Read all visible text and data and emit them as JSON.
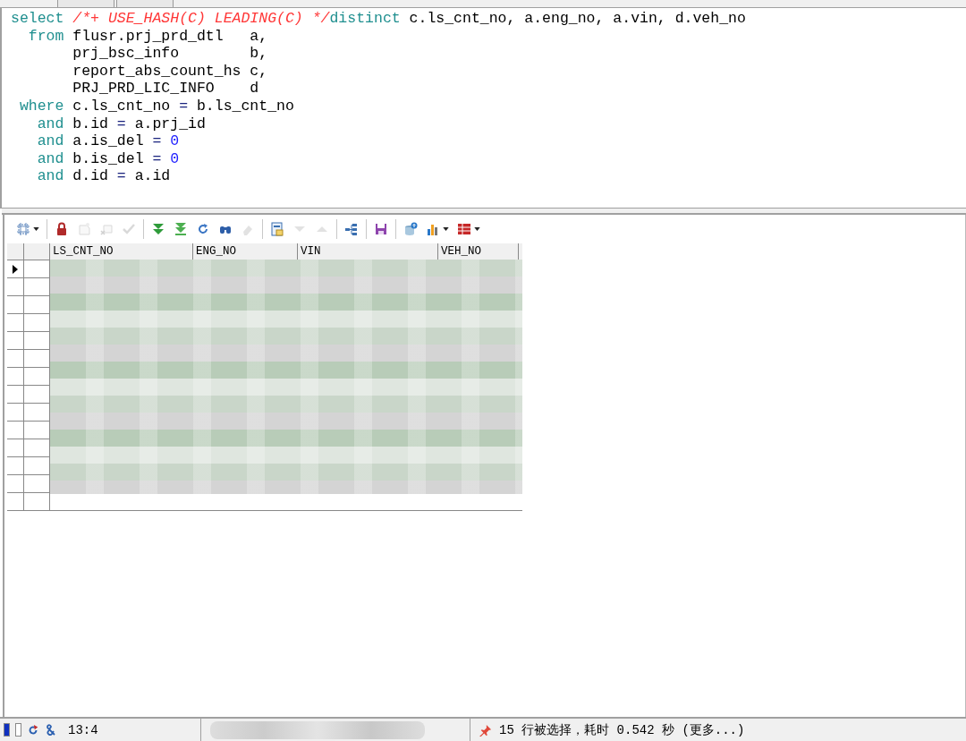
{
  "editor": {
    "lines": [
      [
        {
          "kind": "keyword",
          "text": "select "
        },
        {
          "kind": "comment",
          "text": "/*+ USE_HASH(C) LEADING(C) */"
        },
        {
          "kind": "keyword",
          "text": "distinct"
        },
        {
          "kind": "text",
          "text": " c.ls_cnt_no, a.eng_no, a.vin, d.veh_no"
        }
      ],
      [
        {
          "kind": "keyword",
          "text": "  from"
        },
        {
          "kind": "text",
          "text": " flusr.prj_prd_dtl   a,"
        }
      ],
      [
        {
          "kind": "text",
          "text": "       prj_bsc_info        b,"
        }
      ],
      [
        {
          "kind": "text",
          "text": "       report_abs_count_hs c,"
        }
      ],
      [
        {
          "kind": "text",
          "text": "       PRJ_PRD_LIC_INFO    d"
        }
      ],
      [
        {
          "kind": "keyword",
          "text": " where"
        },
        {
          "kind": "text",
          "text": " c.ls_cnt_no "
        },
        {
          "kind": "operator",
          "text": "="
        },
        {
          "kind": "text",
          "text": " b.ls_cnt_no"
        }
      ],
      [
        {
          "kind": "keyword",
          "text": "   and"
        },
        {
          "kind": "text",
          "text": " b.id "
        },
        {
          "kind": "operator",
          "text": "="
        },
        {
          "kind": "text",
          "text": " a.prj_id"
        }
      ],
      [
        {
          "kind": "keyword",
          "text": "   and"
        },
        {
          "kind": "text",
          "text": " a.is_del "
        },
        {
          "kind": "operator",
          "text": "= "
        },
        {
          "kind": "number",
          "text": "0"
        }
      ],
      [
        {
          "kind": "keyword",
          "text": "   and"
        },
        {
          "kind": "text",
          "text": " b.is_del "
        },
        {
          "kind": "operator",
          "text": "= "
        },
        {
          "kind": "number",
          "text": "0"
        }
      ],
      [
        {
          "kind": "keyword",
          "text": "   and"
        },
        {
          "kind": "text",
          "text": " d.id "
        },
        {
          "kind": "operator",
          "text": "="
        },
        {
          "kind": "text",
          "text": " a.id"
        }
      ]
    ]
  },
  "toolbar": [
    {
      "kind": "button",
      "disabled": false,
      "has_menu": true
    },
    {
      "kind": "separator"
    },
    {
      "kind": "button",
      "disabled": false,
      "has_menu": false
    },
    {
      "kind": "button",
      "disabled": true,
      "has_menu": false
    },
    {
      "kind": "button",
      "disabled": true,
      "has_menu": false
    },
    {
      "kind": "button",
      "disabled": true,
      "has_menu": false
    },
    {
      "kind": "separator"
    },
    {
      "kind": "button",
      "disabled": false,
      "has_menu": false
    },
    {
      "kind": "button",
      "disabled": false,
      "has_menu": false
    },
    {
      "kind": "button",
      "disabled": false,
      "has_menu": false
    },
    {
      "kind": "button",
      "disabled": false,
      "has_menu": false
    },
    {
      "kind": "button",
      "disabled": true,
      "has_menu": false
    },
    {
      "kind": "separator"
    },
    {
      "kind": "button",
      "disabled": false,
      "has_menu": false
    },
    {
      "kind": "button",
      "disabled": true,
      "has_menu": false
    },
    {
      "kind": "button",
      "disabled": true,
      "has_menu": false
    },
    {
      "kind": "separator"
    },
    {
      "kind": "button",
      "disabled": false,
      "has_menu": false
    },
    {
      "kind": "separator"
    },
    {
      "kind": "button",
      "disabled": false,
      "has_menu": false
    },
    {
      "kind": "separator"
    },
    {
      "kind": "button",
      "disabled": false,
      "has_menu": false
    },
    {
      "kind": "button",
      "disabled": false,
      "has_menu": true
    },
    {
      "kind": "button",
      "disabled": false,
      "has_menu": true
    }
  ],
  "grid": {
    "columns": [
      {
        "label": "LS_CNT_NO"
      },
      {
        "label": "ENG_NO"
      },
      {
        "label": "VIN"
      },
      {
        "label": "VEH_NO"
      }
    ]
  },
  "status_bar": {
    "position": "13:4",
    "message": "15 行被选择，耗时 0.542 秒 (更多...)"
  }
}
